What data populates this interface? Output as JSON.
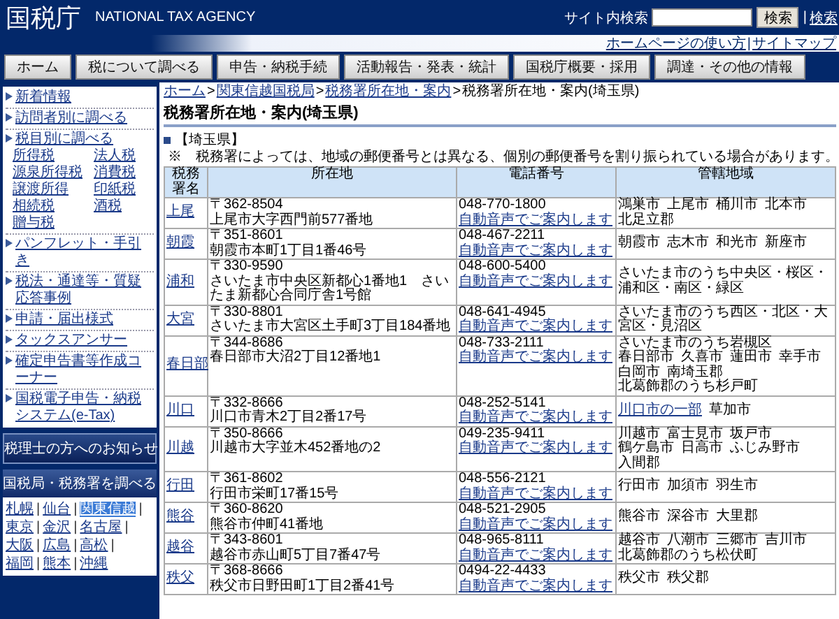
{
  "header": {
    "logo": "国税庁",
    "logo_en": "NATIONAL TAX AGENCY",
    "search_label": "サイト内検索",
    "search_button": "検索",
    "separator": "|",
    "search_help": "検索"
  },
  "utility_links": {
    "separator": "|",
    "links": [
      "ホームページの使い方",
      "サイトマップ"
    ]
  },
  "nav": [
    "ホーム",
    "税について調べる",
    "申告・納税手続",
    "活動報告・発表・統計",
    "国税庁概要・採用",
    "調達・その他の情報"
  ],
  "sidebar": {
    "items": [
      {
        "label": "新着情報"
      },
      {
        "label": "訪問者別に調べる"
      },
      {
        "label": "税目別に調べる",
        "children": [
          "所得税",
          "法人税",
          "源泉所得税",
          "消費税",
          "譲渡所得",
          "印紙税",
          "相続税",
          "酒税",
          "贈与税"
        ]
      },
      {
        "label": "パンフレット・手引き"
      },
      {
        "label": "税法・通達等・質疑応答事例"
      },
      {
        "label": "申請・届出様式"
      },
      {
        "label": "タックスアンサー"
      },
      {
        "label": "確定申告書等作成コーナー"
      },
      {
        "label": "国税電子申告・納税システム(e-Tax)"
      }
    ],
    "notice_button": "税理士の方へのお知らせ",
    "bureau_panel": {
      "title": "国税局・税務署を調べる",
      "separator": "|",
      "links": [
        {
          "label": "札幌",
          "selected": false
        },
        {
          "label": "仙台",
          "selected": false
        },
        {
          "label": "関東信越",
          "selected": true
        },
        {
          "label": "東京",
          "selected": false
        },
        {
          "label": "金沢",
          "selected": false
        },
        {
          "label": "名古屋",
          "selected": false
        },
        {
          "label": "大阪",
          "selected": false
        },
        {
          "label": "広島",
          "selected": false
        },
        {
          "label": "高松",
          "selected": false
        },
        {
          "label": "福岡",
          "selected": false
        },
        {
          "label": "熊本",
          "selected": false
        },
        {
          "label": "沖縄",
          "selected": false
        }
      ]
    }
  },
  "breadcrumb": {
    "separator": ">",
    "items": [
      {
        "label": "ホーム",
        "link": true
      },
      {
        "label": "関東信越国税局",
        "link": true
      },
      {
        "label": "税務署所在地・案内",
        "link": true
      },
      {
        "label": "税務署所在地・案内(埼玉県)",
        "link": false
      }
    ]
  },
  "title": "税務署所在地・案内(埼玉県)",
  "section_heading": "【埼玉県】",
  "note": "※　税務署によっては、地域の郵便番号とは異なる、個別の郵便番号を割り振られている場合があります。",
  "table": {
    "columns": [
      "税務署名",
      "所在地",
      "電話番号",
      "管轄地域"
    ],
    "rows": [
      {
        "name": "上尾",
        "postal": "〒362-8504",
        "address": "上尾市大字西門前577番地",
        "phone": "048-770-1800",
        "voice": "自動音声でご案内します",
        "areas": [
          "鴻巣市",
          "上尾市",
          "桶川市",
          "北本市",
          "北足立郡"
        ]
      },
      {
        "name": "朝霞",
        "postal": "〒351-8601",
        "address": "朝霞市本町1丁目1番46号",
        "phone": "048-467-2211",
        "voice": "自動音声でご案内します",
        "areas": [
          "朝霞市",
          "志木市",
          "和光市",
          "新座市"
        ]
      },
      {
        "name": "浦和",
        "postal": "〒330-9590",
        "address": "さいたま市中央区新都心1番地1　さいたま新都心合同庁舎1号館",
        "phone": "048-600-5400",
        "voice": "自動音声でご案内します",
        "areas": [
          "さいたま市のうち中央区・桜区・浦和区・南区・緑区"
        ]
      },
      {
        "name": "大宮",
        "postal": "〒330-8801",
        "address": "さいたま市大宮区土手町3丁目184番地",
        "phone": "048-641-4945",
        "voice": "自動音声でご案内します",
        "areas": [
          "さいたま市のうち西区・北区・大宮区・見沼区"
        ]
      },
      {
        "name": "春日部",
        "postal": "〒344-8686",
        "address": "春日部市大沼2丁目12番地1",
        "phone": "048-733-2111",
        "voice": "自動音声でご案内します",
        "areas": [
          "さいたま市のうち岩槻区",
          "春日部市",
          "久喜市",
          "蓮田市",
          "幸手市",
          "白岡市",
          "南埼玉郡",
          "北葛飾郡のうち杉戸町"
        ]
      },
      {
        "name": "川口",
        "postal": "〒332-8666",
        "address": "川口市青木2丁目2番17号",
        "phone": "048-252-5141",
        "voice": "自動音声でご案内します",
        "area_link": "川口市の一部",
        "areas": [
          "草加市"
        ]
      },
      {
        "name": "川越",
        "postal": "〒350-8666",
        "address": "川越市大字並木452番地の2",
        "phone": "049-235-9411",
        "voice": "自動音声でご案内します",
        "areas": [
          "川越市",
          "富士見市",
          "坂戸市",
          "鶴ケ島市",
          "日高市",
          "ふじみ野市",
          "入間郡"
        ]
      },
      {
        "name": "行田",
        "postal": "〒361-8602",
        "address": "行田市栄町17番15号",
        "phone": "048-556-2121",
        "voice": "自動音声でご案内します",
        "areas": [
          "行田市",
          "加須市",
          "羽生市"
        ]
      },
      {
        "name": "熊谷",
        "postal": "〒360-8620",
        "address": "熊谷市仲町41番地",
        "phone": "048-521-2905",
        "voice": "自動音声でご案内します",
        "areas": [
          "熊谷市",
          "深谷市",
          "大里郡"
        ]
      },
      {
        "name": "越谷",
        "postal": "〒343-8601",
        "address": "越谷市赤山町5丁目7番47号",
        "phone": "048-965-8111",
        "voice": "自動音声でご案内します",
        "areas": [
          "越谷市",
          "八潮市",
          "三郷市",
          "吉川市",
          "北葛飾郡のうち松伏町"
        ]
      },
      {
        "name": "秩父",
        "postal": "〒368-8666",
        "address": "秩父市日野田町1丁目2番41号",
        "phone": "0494-22-4433",
        "voice": "自動音声でご案内します",
        "areas": [
          "秩父市",
          "秩父郡"
        ]
      }
    ]
  }
}
